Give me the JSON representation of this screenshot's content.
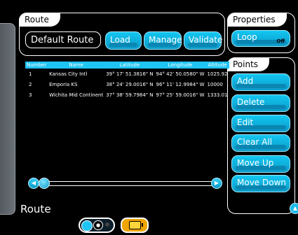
{
  "route_panel": {
    "title": "Route",
    "route_name": "Default Route",
    "buttons": {
      "load": "Load",
      "manage": "Manage",
      "validate": "Validate"
    }
  },
  "properties_panel": {
    "title": "Properties",
    "loop_label": "Loop",
    "loop_state": "Off"
  },
  "points_panel": {
    "title": "Points",
    "buttons": {
      "add": "Add",
      "delete": "Delete",
      "edit": "Edit",
      "clear_all": "Clear All",
      "move_up": "Move Up",
      "move_down": "Move Down"
    }
  },
  "table": {
    "headers": {
      "number": "Number",
      "name": "Name",
      "latitude": "Latitude",
      "longitude": "Longitude",
      "altitude": "Altitude"
    },
    "rows": [
      {
        "number": "1",
        "name": "Kansas City Intl",
        "latitude": "39° 17' 51.3816\" N",
        "longitude": "94° 42' 50.0580\" W",
        "altitude": "1025.92"
      },
      {
        "number": "2",
        "name": "Emporia KS",
        "latitude": "38° 24' 29.0016\" N",
        "longitude": "96° 11' 12.9984\" W",
        "altitude": "10000"
      },
      {
        "number": "3",
        "name": "Wichita Mid Continent",
        "latitude": "37° 38' 59.7984\" N",
        "longitude": "97° 25' 59.0016\" W",
        "altitude": "1333.01"
      }
    ]
  },
  "screen_title": "Route",
  "colors": {
    "accent": "#1ec4f3",
    "battery": "#f0a400"
  },
  "icons": {
    "scroll_left": "chevron-left-icon",
    "scroll_right": "chevron-right-icon",
    "collapse": "chevron-up-icon",
    "battery": "battery-icon",
    "power": "power-toggle-icon"
  }
}
